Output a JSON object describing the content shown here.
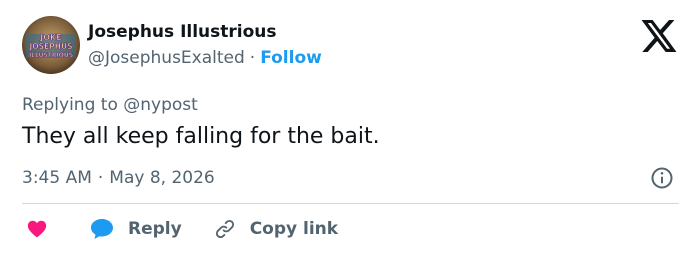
{
  "author": {
    "display_name": "Josephus Illustrious",
    "handle": "@JosephusExalted",
    "separator": "·",
    "follow_label": "Follow",
    "avatar_text": [
      "JOKE",
      "JOSEPHUS",
      "ILLUSTRIOUS"
    ]
  },
  "reply_context": {
    "prefix": "Replying to",
    "mention": "@nypost"
  },
  "tweet": {
    "text": "They all keep falling for the bait.",
    "time": "3:45 AM",
    "separator": "·",
    "date": "May 8, 2026"
  },
  "actions": {
    "reply_label": "Reply",
    "copy_link_label": "Copy link"
  },
  "icons": {
    "logo": "x-logo-icon",
    "info": "info-icon",
    "like": "heart-icon",
    "reply": "speech-bubble-icon",
    "copy_link": "link-icon"
  },
  "colors": {
    "text": "#0f1419",
    "secondary": "#536471",
    "accent": "#1d9bf0",
    "heart": "#f91880",
    "divider": "#cfd9de"
  }
}
